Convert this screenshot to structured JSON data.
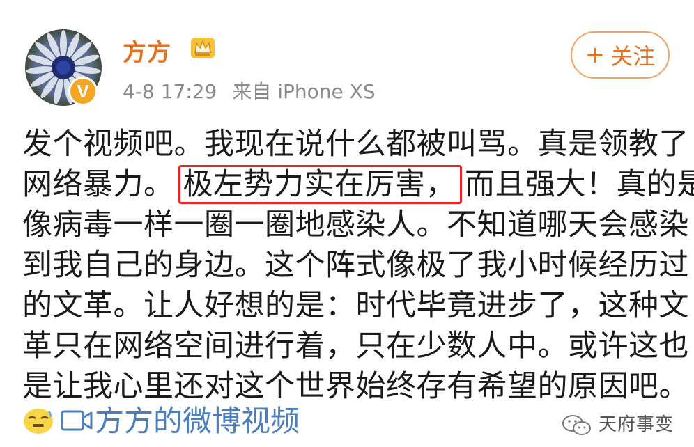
{
  "post": {
    "author": "方方",
    "timestamp": "4-8 17:29",
    "source": "来自 iPhone XS",
    "follow_label": "关注",
    "lines": [
      {
        "text": "发个视频吧。我现在说什么都被叫骂。真是领教了"
      },
      {
        "before": "网络暴力。",
        "highlight": "极左势力实在厉害，",
        "after": "而且强大！真的是"
      },
      {
        "text": "像病毒一样一圈一圈地感染人。不知道哪天会感染"
      },
      {
        "text": "到我自己的身边。这个阵式像极了我小时候经历过"
      },
      {
        "text": "的文革。让人好想的是：时代毕竟进步了，这种文"
      },
      {
        "text": "革只在网络空间进行着，只在少数人中。或许这也"
      },
      {
        "text": "是让我心里还对这个世界始终存有希望的原因吧。"
      }
    ],
    "video_link": "方方的微博视频"
  },
  "watermark": "天府事变",
  "colors": {
    "accent": "#e8721c",
    "link": "#4a7fc0",
    "highlight_border": "#e22222",
    "meta": "#8a8a8a"
  },
  "icons": [
    "avatar",
    "verified-badge-icon",
    "crown-icon",
    "plus-icon",
    "emoji-icon",
    "video-icon",
    "wechat-icon"
  ]
}
